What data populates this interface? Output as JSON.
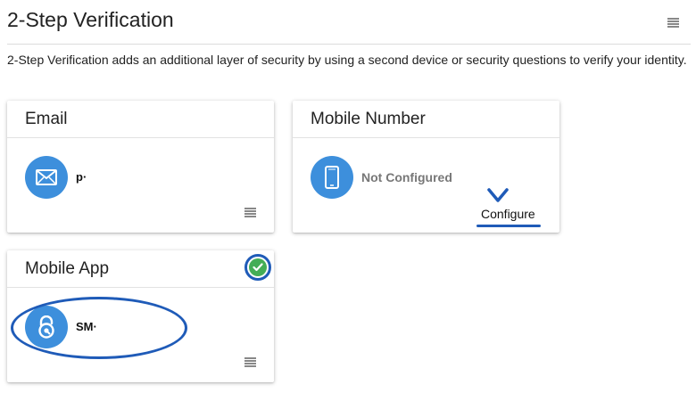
{
  "page": {
    "title": "2-Step Verification",
    "description": "2-Step Verification adds an additional layer of security by using a second device or security questions to verify your identity."
  },
  "cards": {
    "email": {
      "title": "Email",
      "value": "p·",
      "icon": "envelope-icon"
    },
    "mobile_number": {
      "title": "Mobile Number",
      "status": "Not Configured",
      "action": "Configure",
      "icon": "phone-icon"
    },
    "mobile_app": {
      "title": "Mobile App",
      "value": "SM·",
      "icon": "lock-icon",
      "status_icon": "check-circle-icon"
    }
  },
  "colors": {
    "accent": "#3d8fdc",
    "success": "#44ad56",
    "annotation": "#1f5bb8"
  }
}
